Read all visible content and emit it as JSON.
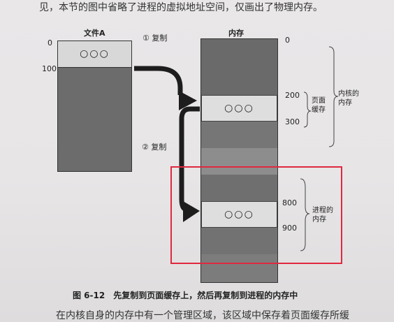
{
  "top_text": "见，本节的图中省略了进程的虚拟地址空间，仅画出了物理内存。",
  "file": {
    "title": "文件A",
    "addr_0": "0",
    "addr_100": "100",
    "page_dots": "○○○"
  },
  "memory": {
    "title": "内存",
    "addr_0": "0",
    "addr_200": "200",
    "addr_300": "300",
    "addr_800": "800",
    "addr_900": "900",
    "page_cache_label": "页面\n缓存",
    "kernel_label": "内核的\n内存",
    "process_label": "进程的\n内存",
    "cache_dots": "○○○",
    "process_dots": "○○○"
  },
  "steps": {
    "step1": "① 复制",
    "step2": "② 复制"
  },
  "caption": "图 6-12　先复制到页面缓存上，然后再复制到进程的内存中",
  "bottom_text": "在内核自身的内存中有一个管理区域，该区域中保存着页面缓存所缓",
  "colors": {
    "highlight_box": "#e0293f",
    "dark_fill": "#6c6c6c"
  }
}
